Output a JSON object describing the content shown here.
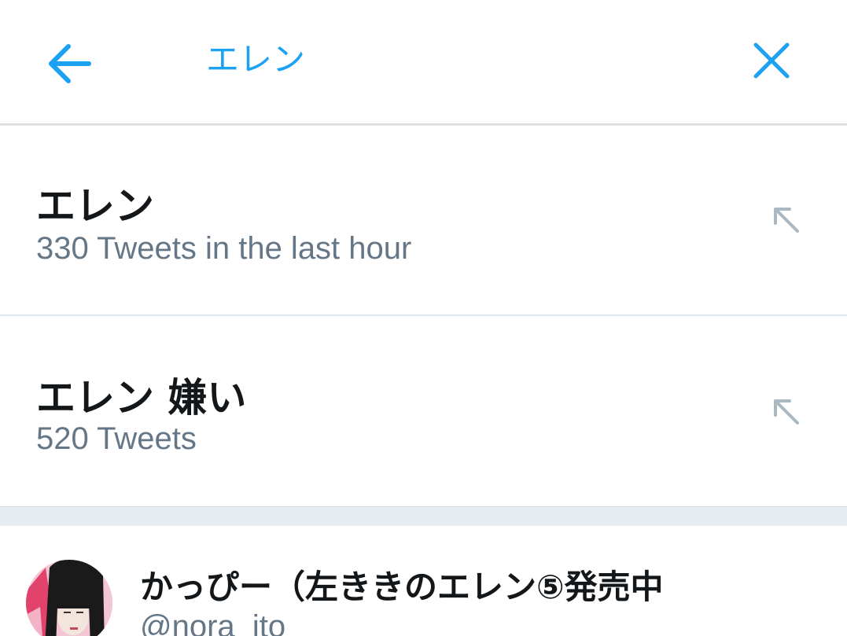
{
  "header": {
    "search_value": "エレン",
    "back_icon": "arrow-left-icon",
    "clear_icon": "close-icon"
  },
  "suggestions": [
    {
      "title": "エレン",
      "count": "330 Tweets in the last hour",
      "icon": "arrow-up-left-icon"
    },
    {
      "title": "エレン 嫌い",
      "count": "520 Tweets",
      "icon": "arrow-up-left-icon"
    }
  ],
  "user": {
    "name": "かっぴー（左ききのエレン⑤発売中",
    "handle": "@nora_ito"
  },
  "colors": {
    "accent": "#1da1f2",
    "primary_text": "#14171a",
    "secondary_text": "#657786",
    "divider": "#e1e8ed",
    "section_bg": "#e6ecf0",
    "arrow_gray": "#aab8c2"
  }
}
